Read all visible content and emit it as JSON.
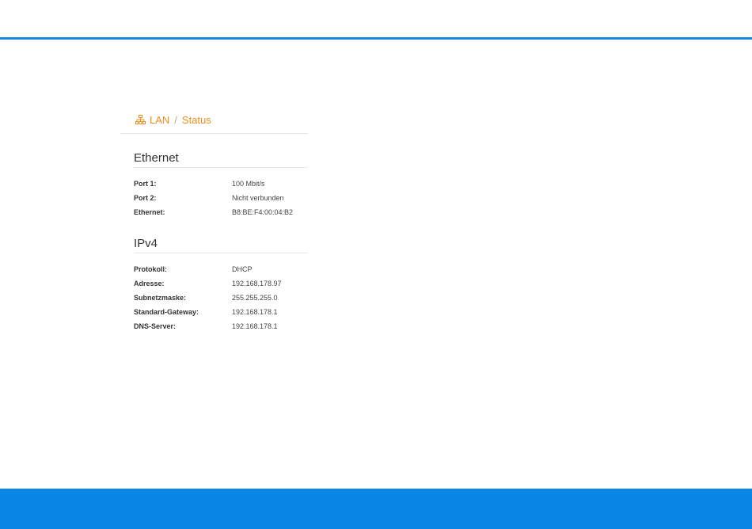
{
  "breadcrumb": {
    "icon": "network-icon",
    "items": [
      "LAN",
      "Status"
    ],
    "separator": "/",
    "color": "#ef8d1e"
  },
  "ethernet": {
    "title": "Ethernet",
    "rows": [
      {
        "label": "Port 1:",
        "value": "100 Mbit/s"
      },
      {
        "label": "Port 2:",
        "value": "Nicht verbunden"
      },
      {
        "label": "Ethernet:",
        "value": "B8:BE:F4:00:04:B2"
      }
    ]
  },
  "ipv4": {
    "title": "IPv4",
    "rows": [
      {
        "label": "Protokoll:",
        "value": "DHCP"
      },
      {
        "label": "Adresse:",
        "value": "192.168.178.97"
      },
      {
        "label": "Subnetzmaske:",
        "value": "255.255.255.0"
      },
      {
        "label": "Standard-Gateway:",
        "value": "192.168.178.1"
      },
      {
        "label": "DNS-Server:",
        "value": "192.168.178.1"
      }
    ]
  },
  "colors": {
    "top_rule": "#1a88e2",
    "bottom_bar": "#0a86e6"
  }
}
